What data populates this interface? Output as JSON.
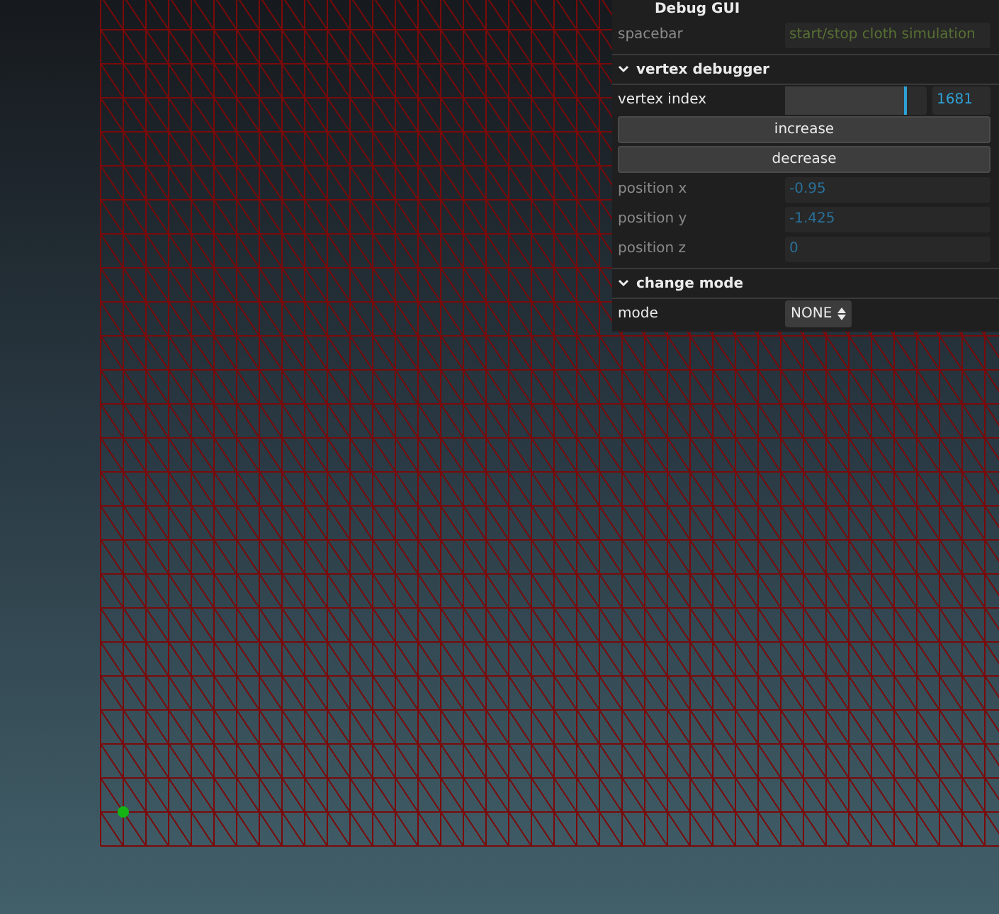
{
  "panel": {
    "title": "Debug GUI",
    "controls": [
      {
        "kind": "text",
        "label": "spacebar",
        "value": "start/stop cloth simulation",
        "disabled": true
      },
      {
        "kind": "folder",
        "label": "vertex debugger",
        "expanded": true
      },
      {
        "kind": "slider",
        "label": "vertex index",
        "level": 0.84,
        "value": "1681"
      },
      {
        "kind": "button",
        "label": "increase"
      },
      {
        "kind": "button",
        "label": "decrease"
      },
      {
        "kind": "number",
        "label": "position x",
        "value": "-0.95",
        "disabled": true
      },
      {
        "kind": "number",
        "label": "position y",
        "value": "-1.425",
        "disabled": true
      },
      {
        "kind": "number",
        "label": "position z",
        "value": "0",
        "disabled": true
      },
      {
        "kind": "folder",
        "label": "change mode",
        "expanded": true
      },
      {
        "kind": "select",
        "label": "mode",
        "value": "NONE",
        "disabled": false
      }
    ]
  }
}
